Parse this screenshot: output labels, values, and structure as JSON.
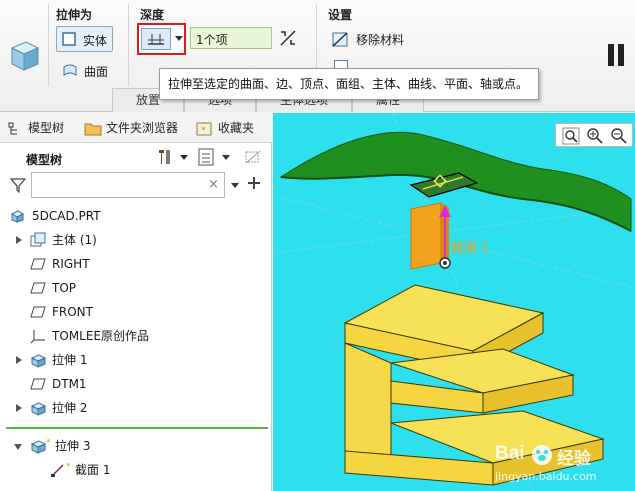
{
  "ribbon": {
    "extrude_as_title": "拉伸为",
    "solid_label": "实体",
    "surface_label": "曲面",
    "depth_title": "深度",
    "depth_value": "1个项",
    "settings_title": "设置",
    "remove_material_label": "移除材料",
    "tabs": [
      "放置",
      "选项",
      "主体选项",
      "属性"
    ]
  },
  "tooltip": "拉伸至选定的曲面、边、顶点、面组、主体、曲线、平面、轴或点。",
  "panel": {
    "tabs": [
      "模型树",
      "文件夹浏览器",
      "收藏夹"
    ],
    "tree_title": "模型树",
    "filter_placeholder": "",
    "filter_clear": "×"
  },
  "tree": {
    "items": [
      {
        "label": "5DCAD.PRT"
      },
      {
        "label": "主体 (1)"
      },
      {
        "label": "RIGHT"
      },
      {
        "label": "TOP"
      },
      {
        "label": "FRONT"
      },
      {
        "label": "TOMLEE原创作品"
      },
      {
        "label": "拉伸 1"
      },
      {
        "label": "DTM1"
      },
      {
        "label": "拉伸 2"
      },
      {
        "label": "拉伸 3"
      },
      {
        "label": "截面 1"
      }
    ]
  },
  "viewport": {
    "section_label": "截面 1",
    "background_color": "#2ee0ee",
    "surface_color": "#1f8f1f",
    "part_color": "#f6d84a",
    "preview_color": "#f2a21c"
  },
  "watermark": {
    "brand": "Bai",
    "brand_suffix": "经验",
    "url": "jingyan.baidu.com"
  },
  "icons": {
    "extrude": "extrude-cube-icon",
    "pause": "pause-icon"
  }
}
